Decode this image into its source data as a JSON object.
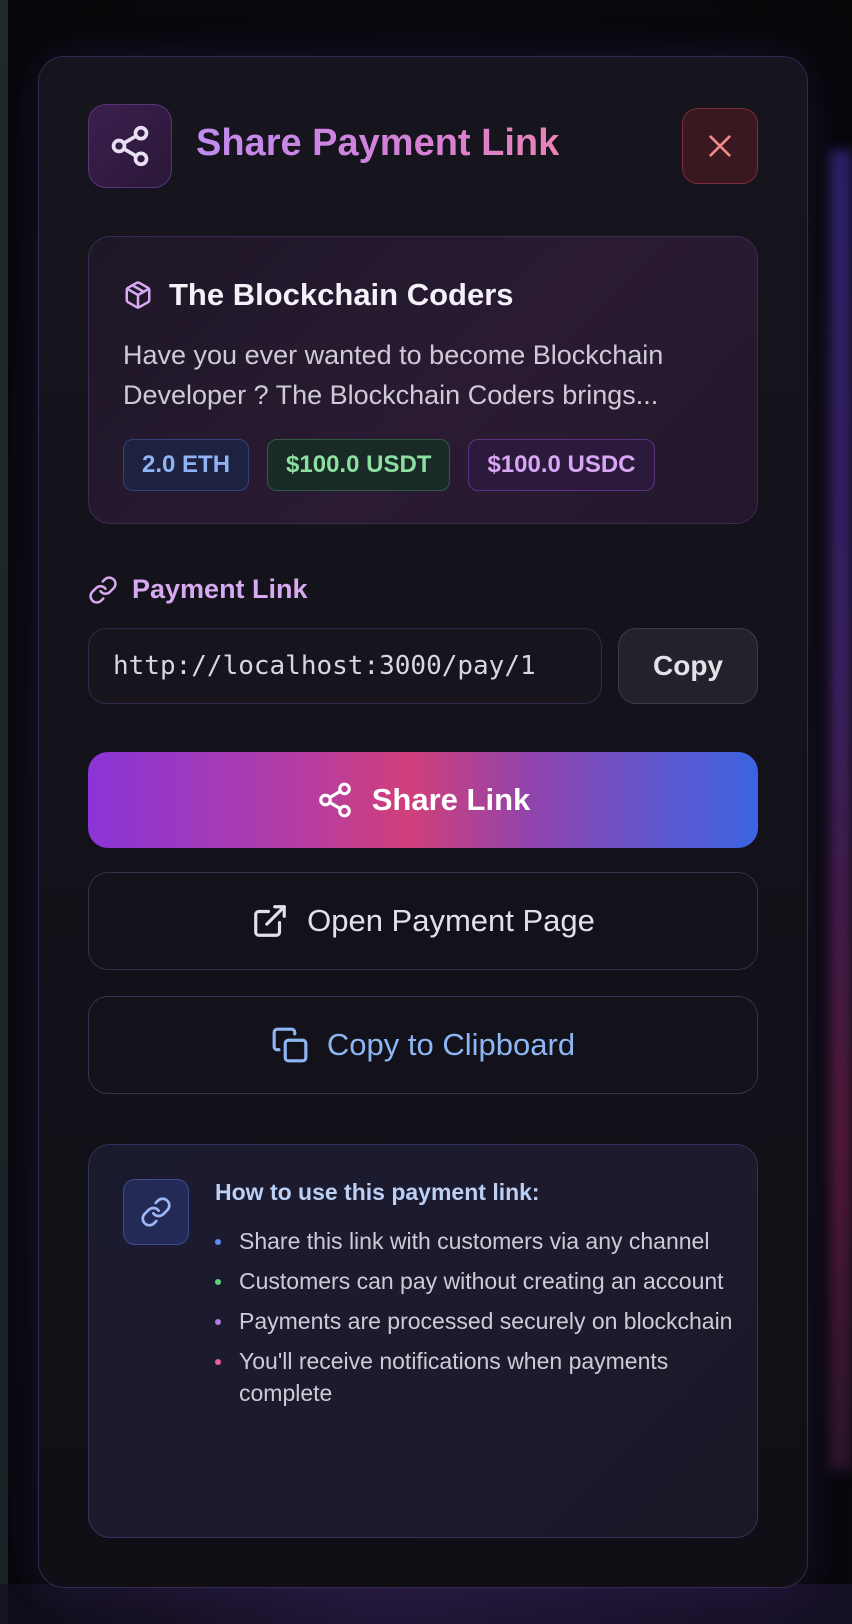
{
  "modal": {
    "title": "Share Payment Link",
    "close_label": "×"
  },
  "product": {
    "name": "The Blockchain Coders",
    "description": "Have you ever wanted to become Blockchain Developer ? The Blockchain Coders brings...",
    "prices": [
      {
        "label": "2.0 ETH",
        "color": "#8fb3f5"
      },
      {
        "label": "$100.0 USDT",
        "color": "#8be0a0"
      },
      {
        "label": "$100.0 USDC",
        "color": "#d9a5f5"
      }
    ]
  },
  "payment_link": {
    "label": "Payment Link",
    "value": "http://localhost:3000/pay/1",
    "copy_label": "Copy"
  },
  "actions": {
    "share_label": "Share Link",
    "open_label": "Open Payment Page",
    "clipboard_label": "Copy to Clipboard"
  },
  "info": {
    "title": "How to use this payment link:",
    "items": [
      {
        "text": "Share this link with customers via any channel",
        "dot_color": "#5a8ef0"
      },
      {
        "text": "Customers can pay without creating an account",
        "dot_color": "#5fd27a"
      },
      {
        "text": "Payments are processed securely on blockchain",
        "dot_color": "#b579e8"
      },
      {
        "text": "You'll receive notifications when payments complete",
        "dot_color": "#e85d9c"
      }
    ]
  },
  "colors": {
    "accent_purple": "#c08cf0",
    "accent_pink": "#e883b6",
    "accent_blue": "#3b64e2"
  }
}
